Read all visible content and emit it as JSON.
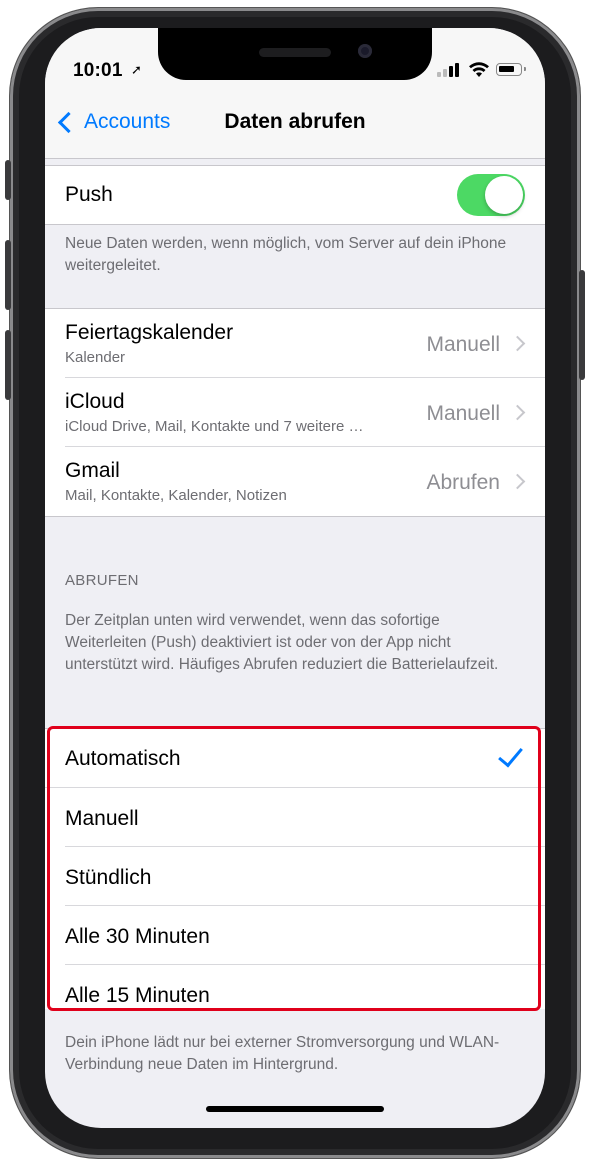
{
  "status_bar": {
    "time": "10:01"
  },
  "nav": {
    "back_label": "Accounts",
    "title": "Daten abrufen"
  },
  "push": {
    "label": "Push",
    "enabled": true,
    "footer": "Neue Daten werden, wenn möglich, vom Server auf dein iPhone weitergeleitet."
  },
  "accounts": [
    {
      "name": "Feiertagskalender",
      "detail": "Kalender",
      "value": "Manuell"
    },
    {
      "name": "iCloud",
      "detail": "iCloud Drive, Mail, Kontakte und 7 weitere …",
      "value": "Manuell"
    },
    {
      "name": "Gmail",
      "detail": "Mail, Kontakte, Kalender, Notizen",
      "value": "Abrufen"
    }
  ],
  "fetch": {
    "header": "ABRUFEN",
    "description": "Der Zeitplan unten wird verwendet, wenn das sofortige Weiterleiten (Push) deaktiviert ist oder von der App nicht unterstützt wird. Häufiges Abrufen reduziert die Batterielaufzeit.",
    "options": [
      "Automatisch",
      "Manuell",
      "Stündlich",
      "Alle 30 Minuten",
      "Alle 15 Minuten"
    ],
    "selected": "Automatisch",
    "footer": "Dein iPhone lädt nur bei externer Stromversorgung und WLAN-Verbindung neue Daten im Hintergrund."
  },
  "colors": {
    "accent": "#007aff",
    "toggle_on": "#4cd964",
    "highlight": "#e0001b"
  }
}
